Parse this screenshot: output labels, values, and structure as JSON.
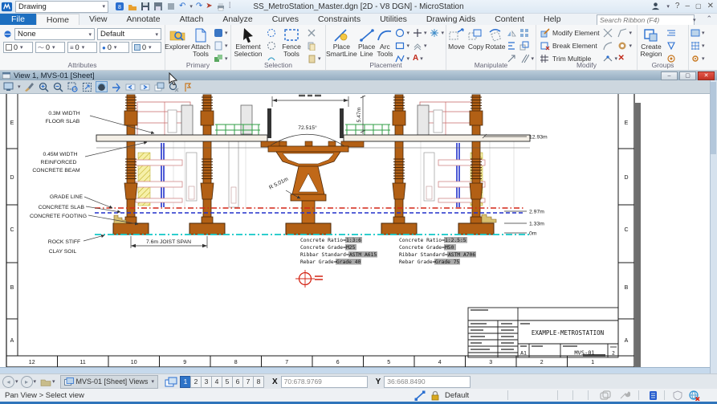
{
  "titlebar": {
    "workflow": "Drawing",
    "title": "SS_MetroStation_Master.dgn [2D - V8 DGN] - MicroStation",
    "search_placeholder": "Search Ribbon (F4)"
  },
  "tabs": {
    "file": "File",
    "items": [
      "Home",
      "View",
      "Annotate",
      "Attach",
      "Analyze",
      "Curves",
      "Constraints",
      "Utilities",
      "Drawing Aids",
      "Content",
      "Help"
    ]
  },
  "ribbon": {
    "attributes": {
      "label": "Attributes",
      "level": "None",
      "style": "Default",
      "v1": "0",
      "v2": "0",
      "v3": "0",
      "v4": "0",
      "v5": "0"
    },
    "primary": {
      "label": "Primary",
      "explorer": "Explorer",
      "attach": "Attach Tools"
    },
    "selection": {
      "label": "Selection",
      "element": "Element Selection",
      "fence": "Fence Tools"
    },
    "placement": {
      "label": "Placement",
      "smartline": "Place SmartLine",
      "line": "Place Line",
      "arc": "Arc Tools"
    },
    "manipulate": {
      "label": "Manipulate",
      "move": "Move",
      "copy": "Copy",
      "rotate": "Rotate"
    },
    "modify": {
      "label": "Modify",
      "modify": "Modify Element",
      "break": "Break Element",
      "trim": "Trim Multiple"
    },
    "groups": {
      "label": "Groups",
      "region": "Create Region"
    }
  },
  "view": {
    "title": "View 1, MVS-01 [Sheet]"
  },
  "sheet": {
    "rows": [
      "E",
      "D",
      "C",
      "B",
      "A"
    ],
    "cols": [
      "12",
      "11",
      "10",
      "9",
      "8",
      "7",
      "6",
      "5",
      "4",
      "3",
      "2",
      "1"
    ]
  },
  "drawing": {
    "ann": {
      "floor1": "0.3M WIDTH",
      "floor2": "FLOOR SLAB",
      "beam1": "0.45M WIDTH",
      "beam2": "REINFORCED",
      "beam3": "CONCRETE BEAM",
      "grade": "GRADE LINE",
      "slab": "CONCRETE SLAB",
      "footing": "CONCRETE FOOTING",
      "rock1": "ROCK STIFF",
      "rock2": "CLAY SOIL"
    },
    "dims": {
      "angle": "72.515°",
      "radius": "R 5.01m",
      "height": "5.47m",
      "e1": "12.93m",
      "e2": "2.97m",
      "e3": "1.33m",
      "e4": "0m",
      "joist": "7.6m JOIST SPAN"
    },
    "notes_left": [
      {
        "label": "Concrete Ratio=",
        "value": "1:3:6"
      },
      {
        "label": "Concrete Grade=",
        "value": "M25"
      },
      {
        "label": "Ribbar Standard=",
        "value": "ASTM A615"
      },
      {
        "label": "Rebar Grade=",
        "value": "Grade 40"
      }
    ],
    "notes_right": [
      {
        "label": "Concrete Ratio=",
        "value": "1:2.5:5"
      },
      {
        "label": "Concrete Grade=",
        "value": "M50"
      },
      {
        "label": "Ribbar Standard=",
        "value": "ASTM A706"
      },
      {
        "label": "Rebar Grade=",
        "value": "Grade 75"
      }
    ],
    "titleblock": {
      "title": "EXAMPLE-METROSTATION",
      "size": "A1",
      "number": "MVS-01",
      "rev": "2"
    }
  },
  "statusbar": {
    "views_button": "MVS-01 [Sheet] Views",
    "view_numbers": [
      "1",
      "2",
      "3",
      "4",
      "5",
      "6",
      "7",
      "8"
    ],
    "x_label": "X",
    "x_value": "70:678.9769",
    "y_label": "Y",
    "y_value": "36:668.8490",
    "prompt": "Pan View > Select view",
    "level": "Default"
  }
}
